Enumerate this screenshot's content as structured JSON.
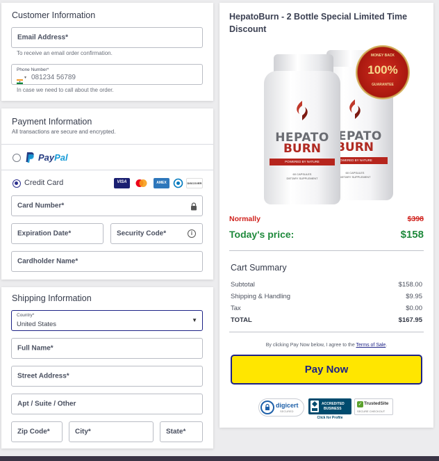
{
  "customer": {
    "title": "Customer Information",
    "email_label": "Email Address*",
    "email_help": "To receive an email order confirmation.",
    "phone_label": "Phone Number*",
    "phone_placeholder": "081234 56789",
    "phone_help": "In case we need to call about the order."
  },
  "payment": {
    "title": "Payment Information",
    "subtitle": "All transactions are secure and encrypted.",
    "paypal_pay": "Pay",
    "paypal_pal": "Pal",
    "credit_card_label": "Credit Card",
    "card_logos": [
      "VISA",
      "mastercard",
      "AMEX",
      "diners-club",
      "DISCOVER"
    ],
    "card_number_label": "Card Number*",
    "expiration_label": "Expiration Date*",
    "security_label": "Security Code*",
    "cardholder_label": "Cardholder Name*"
  },
  "shipping": {
    "title": "Shipping Information",
    "country_label": "Country*",
    "country_value": "United States",
    "full_name_label": "Full Name*",
    "street_label": "Street Address*",
    "apt_label": "Apt / Suite / Other",
    "zip_label": "Zip Code*",
    "city_label": "City*",
    "state_label": "State*"
  },
  "product": {
    "title": "HepatoBurn - 2 Bottle Special Limited Time Discount",
    "bottle_brand_top": "HEPATO",
    "bottle_brand_bottom": "BURN",
    "bottle_band": "POWERED BY NATURE",
    "bottle_caps": "60 CAPSULES",
    "bottle_sub": "DIETARY SUPPLEMENT",
    "seal_top": "MONEY BACK",
    "seal_mid": "100%",
    "seal_bottom": "GUARANTEE"
  },
  "pricing": {
    "normally_label": "Normally",
    "normally_price": "$398",
    "today_label": "Today's price:",
    "today_price": "$158"
  },
  "cart": {
    "title": "Cart Summary",
    "rows": [
      {
        "label": "Subtotal",
        "value": "$158.00"
      },
      {
        "label": "Shipping & Handling",
        "value": "$9.95"
      },
      {
        "label": "Tax",
        "value": "$0.00"
      },
      {
        "label": "TOTAL",
        "value": "$167.95"
      }
    ]
  },
  "terms": {
    "prefix": "By clicking Pay Now below, I agree to the ",
    "link": "Terms of Sale",
    "suffix": "."
  },
  "pay_button": "Pay Now",
  "trust": {
    "digicert": "digicert",
    "digicert_sub": "SECURED",
    "bbb_line1": "ACCREDITED",
    "bbb_line2": "BUSINESS",
    "bbb_caption": "Click for Profile",
    "trustedsite": "TrustedSite",
    "trustedsite_sub": "SECURE CHECKOUT"
  },
  "colors": {
    "accent": "#1d2286",
    "pay_button_bg": "#ffe600",
    "normally_red": "#d0211c",
    "today_green": "#1f8a3c"
  }
}
